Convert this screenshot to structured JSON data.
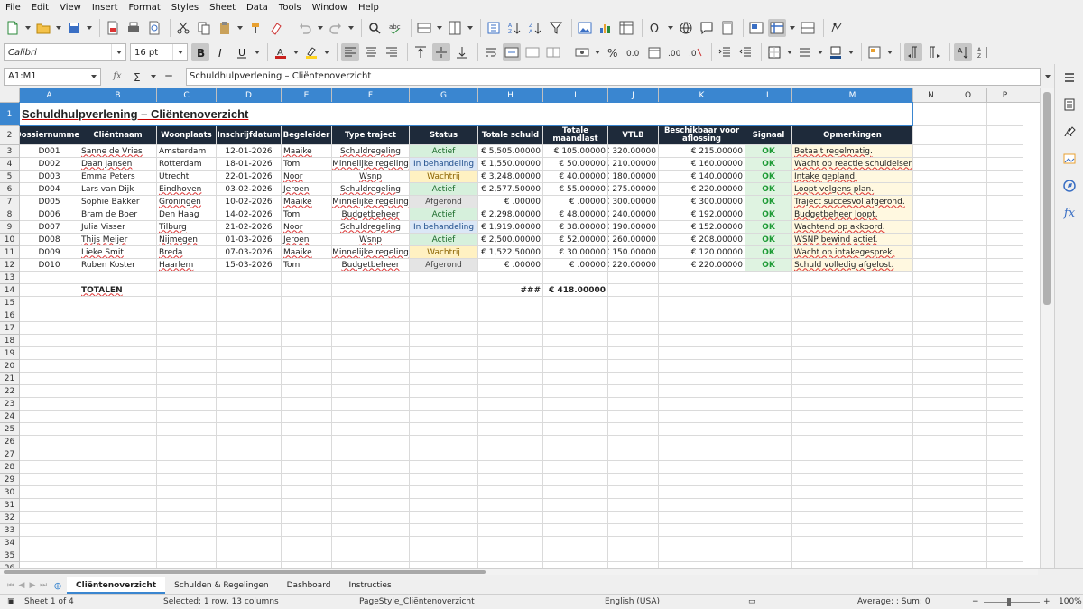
{
  "menu": [
    "File",
    "Edit",
    "View",
    "Insert",
    "Format",
    "Styles",
    "Sheet",
    "Data",
    "Tools",
    "Window",
    "Help"
  ],
  "font_name": "Calibri",
  "font_size": "16 pt",
  "name_box": "A1:M1",
  "formula": "Schuldhulpverlening – Cliëntenoverzicht",
  "columns": [
    "A",
    "B",
    "C",
    "D",
    "E",
    "F",
    "G",
    "H",
    "I",
    "J",
    "K",
    "L",
    "M",
    "N",
    "O",
    "P"
  ],
  "rows": [
    "1",
    "2",
    "3",
    "4",
    "5",
    "6",
    "7",
    "8",
    "9",
    "10",
    "11",
    "12",
    "13",
    "14",
    "15",
    "16",
    "17",
    "18",
    "19",
    "20",
    "21",
    "22",
    "23",
    "24",
    "25",
    "26",
    "27",
    "28",
    "29",
    "30",
    "31",
    "32",
    "33",
    "34",
    "35",
    "36"
  ],
  "title": "Schuldhulpverlening – Cliëntenoverzicht",
  "headers": [
    "Dossiernummer",
    "Cliëntnaam",
    "Woonplaats",
    "Inschrijfdatum",
    "Begeleider",
    "Type traject",
    "Status",
    "Totale schuld",
    "Totale maandlast",
    "VTLB",
    "Beschikbaar voor aflossing",
    "Signaal",
    "Opmerkingen"
  ],
  "data_rows": [
    [
      "D001",
      "Sanne de Vries",
      "Amsterdam",
      "12-01-2026",
      "Maaike",
      "Schuldregeling",
      "Actief",
      "€ 5,505.00000",
      "€ 105.00000",
      "€ 320.00000",
      "€ 215.00000",
      "OK",
      "Betaalt regelmatig."
    ],
    [
      "D002",
      "Daan Jansen",
      "Rotterdam",
      "18-01-2026",
      "Tom",
      "Minnelijke regeling",
      "In behandeling",
      "€ 1,550.00000",
      "€ 50.00000",
      "€ 210.00000",
      "€ 160.00000",
      "OK",
      "Wacht op reactie schuldeiser."
    ],
    [
      "D003",
      "Emma Peters",
      "Utrecht",
      "22-01-2026",
      "Noor",
      "Wsnp",
      "Wachtrij",
      "€ 3,248.00000",
      "€ 40.00000",
      "€ 180.00000",
      "€ 140.00000",
      "OK",
      "Intake gepland."
    ],
    [
      "D004",
      "Lars van Dijk",
      "Eindhoven",
      "03-02-2026",
      "Jeroen",
      "Schuldregeling",
      "Actief",
      "€ 2,577.50000",
      "€ 55.00000",
      "€ 275.00000",
      "€ 220.00000",
      "OK",
      "Loopt volgens plan."
    ],
    [
      "D005",
      "Sophie Bakker",
      "Groningen",
      "10-02-2026",
      "Maaike",
      "Minnelijke regeling",
      "Afgerond",
      "€ .00000",
      "€ .00000",
      "€ 300.00000",
      "€ 300.00000",
      "OK",
      "Traject succesvol afgerond."
    ],
    [
      "D006",
      "Bram de Boer",
      "Den Haag",
      "14-02-2026",
      "Tom",
      "Budgetbeheer",
      "Actief",
      "€ 2,298.00000",
      "€ 48.00000",
      "€ 240.00000",
      "€ 192.00000",
      "OK",
      "Budgetbeheer loopt."
    ],
    [
      "D007",
      "Julia Visser",
      "Tilburg",
      "21-02-2026",
      "Noor",
      "Schuldregeling",
      "In behandeling",
      "€ 1,919.00000",
      "€ 38.00000",
      "€ 190.00000",
      "€ 152.00000",
      "OK",
      "Wachtend op akkoord."
    ],
    [
      "D008",
      "Thijs Meijer",
      "Nijmegen",
      "01-03-2026",
      "Jeroen",
      "Wsnp",
      "Actief",
      "€ 2,500.00000",
      "€ 52.00000",
      "€ 260.00000",
      "€ 208.00000",
      "OK",
      "WSNP bewind actief."
    ],
    [
      "D009",
      "Lieke Smit",
      "Breda",
      "07-03-2026",
      "Maaike",
      "Minnelijke regeling",
      "Wachtrij",
      "€ 1,522.50000",
      "€ 30.00000",
      "€ 150.00000",
      "€ 120.00000",
      "OK",
      "Wacht op intakegesprek."
    ],
    [
      "D010",
      "Ruben Koster",
      "Haarlem",
      "15-03-2026",
      "Tom",
      "Budgetbeheer",
      "Afgerond",
      "€ .00000",
      "€ .00000",
      "€ 220.00000",
      "€ 220.00000",
      "OK",
      "Schuld volledig afgelost."
    ]
  ],
  "totals_label": "TOTALEN",
  "totals_debt": "###",
  "totals_monthly": "€ 418.00000",
  "sheet_tabs": [
    "Cliëntenoverzicht",
    "Schulden & Regelingen",
    "Dashboard",
    "Instructies"
  ],
  "status": {
    "sheet": "Sheet 1 of 4",
    "selection": "Selected: 1 row, 13 columns",
    "page_style": "PageStyle_Cliëntenoverzicht",
    "language": "English (USA)",
    "sum": "Average: ; Sum: 0",
    "zoom": "100%"
  },
  "colors": {
    "header_bg": "#1e2a3a",
    "selection": "#3a86d0",
    "ok": "#1d9a35"
  }
}
